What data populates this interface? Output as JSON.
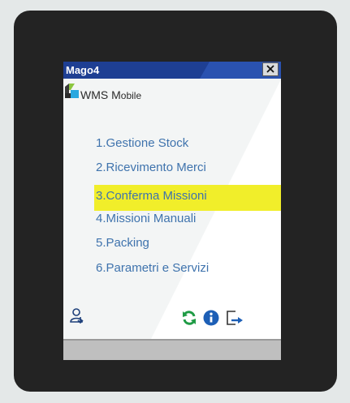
{
  "window": {
    "title": "Mago4",
    "close_glyph": "✕"
  },
  "brand": {
    "name_main": "WMS M",
    "name_small": "obile",
    "logo_icon": "wms-logo-icon"
  },
  "menu": {
    "items": [
      {
        "label": "1.Gestione Stock",
        "selected": false
      },
      {
        "label": "2.Ricevimento Merci",
        "selected": false
      },
      {
        "label": "3.Conferma Missioni",
        "selected": true
      },
      {
        "label": "4.Missioni Manuali",
        "selected": false
      },
      {
        "label": "5.Packing",
        "selected": false
      },
      {
        "label": "6.Parametri e Servizi",
        "selected": false
      }
    ]
  },
  "toolbar": {
    "icons": [
      "user-switch-icon",
      "refresh-icon",
      "info-icon",
      "logout-icon"
    ]
  },
  "colors": {
    "titlebar": "#1e3f93",
    "menu_text": "#3f73ad",
    "selection": "#f1ee2a",
    "refresh": "#1f9b45",
    "info": "#1d5fb6"
  }
}
